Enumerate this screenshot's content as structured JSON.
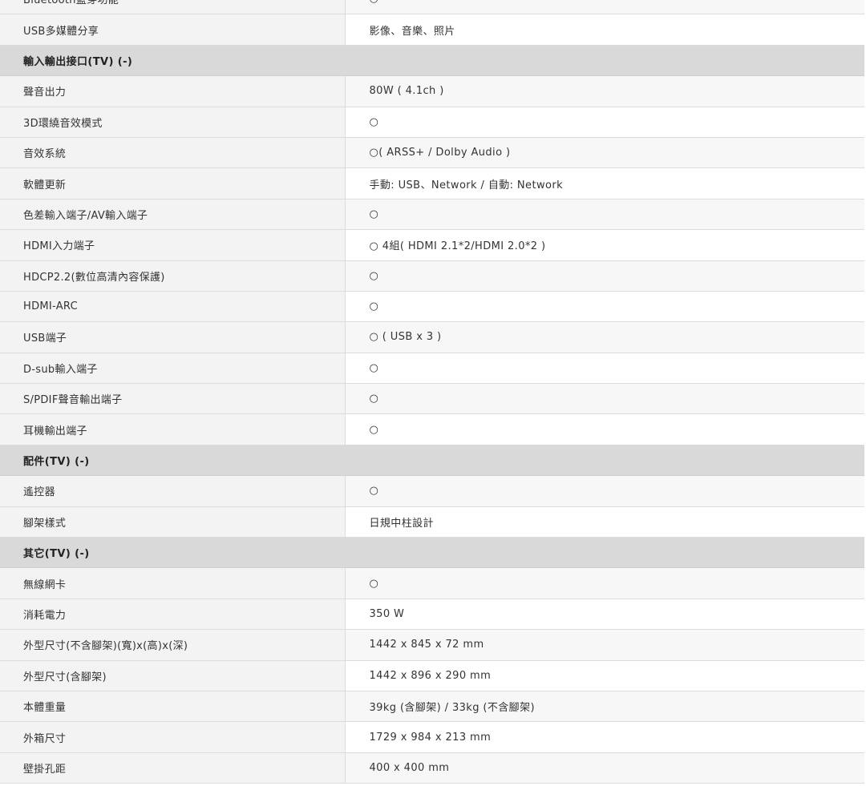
{
  "rows": [
    {
      "type": "row",
      "label": "Bluetooth藍芽功能",
      "value": "○"
    },
    {
      "type": "row",
      "label": "USB多媒體分享",
      "value": "影像、音樂、照片"
    },
    {
      "type": "section",
      "label": "輸入輸出接口(TV) (-)"
    },
    {
      "type": "row",
      "label": "聲音出力",
      "value": "80W ( 4.1ch )"
    },
    {
      "type": "row",
      "label": "3D環繞音效模式",
      "value": "○"
    },
    {
      "type": "row",
      "label": "音效系統",
      "value": "○( ARSS+ / Dolby Audio )"
    },
    {
      "type": "row",
      "label": "軟體更新",
      "value": "手動: USB、Network / 自動: Network"
    },
    {
      "type": "row",
      "label": "色差輸入端子/AV輸入端子",
      "value": "○"
    },
    {
      "type": "row",
      "label": "HDMI入力端子",
      "value": "○ 4組( HDMI 2.1*2/HDMI 2.0*2 )"
    },
    {
      "type": "row",
      "label": "HDCP2.2(數位高清內容保護)",
      "value": "○"
    },
    {
      "type": "row",
      "label": "HDMI-ARC",
      "value": "○"
    },
    {
      "type": "row",
      "label": "USB端子",
      "value": "○ ( USB x 3 )"
    },
    {
      "type": "row",
      "label": "D-sub輸入端子",
      "value": "○"
    },
    {
      "type": "row",
      "label": "S/PDIF聲音輸出端子",
      "value": "○"
    },
    {
      "type": "row",
      "label": "耳機輸出端子",
      "value": "○"
    },
    {
      "type": "section",
      "label": "配件(TV) (-)"
    },
    {
      "type": "row",
      "label": "遙控器",
      "value": "○"
    },
    {
      "type": "row",
      "label": "腳架樣式",
      "value": "日規中柱設計"
    },
    {
      "type": "section",
      "label": "其它(TV) (-)"
    },
    {
      "type": "row",
      "label": "無線網卡",
      "value": "○"
    },
    {
      "type": "row",
      "label": "消耗電力",
      "value": "350 W"
    },
    {
      "type": "row",
      "label": "外型尺寸(不含腳架)(寬)x(高)x(深)",
      "value": "1442 x 845 x 72 mm"
    },
    {
      "type": "row",
      "label": "外型尺寸(含腳架)",
      "value": "1442 x 896 x 290 mm"
    },
    {
      "type": "row",
      "label": "本體重量",
      "value": "39kg (含腳架) / 33kg (不含腳架)"
    },
    {
      "type": "row",
      "label": "外箱尺寸",
      "value": "1729 x 984 x 213 mm"
    },
    {
      "type": "row",
      "label": "壁掛孔距",
      "value": "400 x 400 mm"
    }
  ]
}
